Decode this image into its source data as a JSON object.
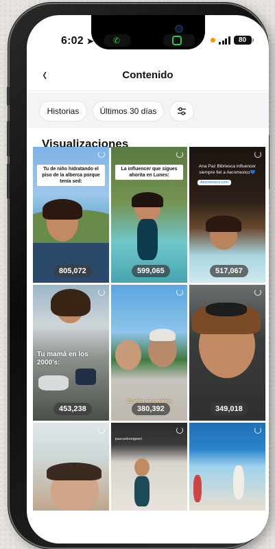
{
  "status": {
    "time": "6:02",
    "battery": "80"
  },
  "header": {
    "back_label": "‹",
    "title": "Contenido"
  },
  "filters": {
    "items": [
      "Historias",
      "Últimos 30 días"
    ],
    "settings_icon": "sliders-icon"
  },
  "section": {
    "title": "Visualizaciones"
  },
  "tiles": [
    {
      "views": "805,072",
      "caption": "Tu de niño hidratando el piso de la alberca porque tenía sed:"
    },
    {
      "views": "599,065",
      "caption": "La influencer que sigues ahorita en Lunes:"
    },
    {
      "views": "517,067",
      "caption": "Ana Paz Bibriesca influencer siempre fiel a Aeromexico💙",
      "tag": "Aeromexico.com"
    },
    {
      "views": "453,238",
      "caption": "Tu mamá en los 2000's:"
    },
    {
      "views": "380,392",
      "caption": "20 años de casados"
    },
    {
      "views": "349,018",
      "caption": ""
    },
    {
      "views": "",
      "caption": ""
    },
    {
      "views": "",
      "caption": "pazcarbonigeeri"
    },
    {
      "views": "",
      "caption": ""
    }
  ],
  "colors": {
    "accent": "#111111",
    "chip_bg": "#ffffff",
    "filter_bar": "#f4f4f6"
  }
}
